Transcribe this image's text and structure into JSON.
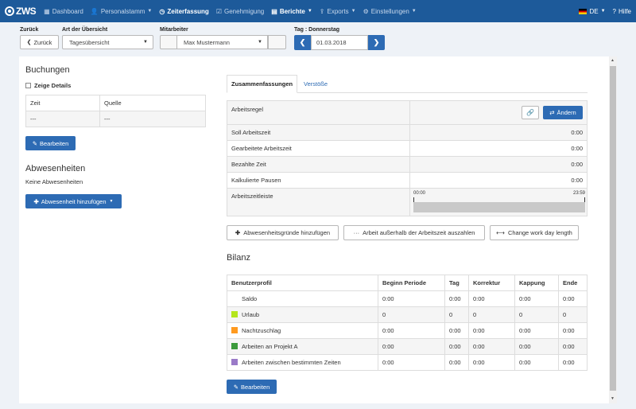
{
  "nav": {
    "logo": "ZWS",
    "items": [
      {
        "label": "Dashboard",
        "icon": "grid-icon",
        "glyph": "▦",
        "active": false,
        "caret": false
      },
      {
        "label": "Personalstamm",
        "icon": "user-icon",
        "glyph": "👤",
        "active": false,
        "caret": true
      },
      {
        "label": "Zeiterfassung",
        "icon": "clock-icon",
        "glyph": "◷",
        "active": true,
        "caret": false
      },
      {
        "label": "Genehmigung",
        "icon": "check-square-icon",
        "glyph": "☑",
        "active": false,
        "caret": false
      },
      {
        "label": "Berichte",
        "icon": "print-icon",
        "glyph": "▤",
        "active": true,
        "caret": true
      },
      {
        "label": "Exports",
        "icon": "export-icon",
        "glyph": "⇪",
        "active": false,
        "caret": true
      },
      {
        "label": "Einstellungen",
        "icon": "gear-icon",
        "glyph": "⚙",
        "active": false,
        "caret": true
      }
    ],
    "language": "DE",
    "help": "Hilfe",
    "help_glyph": "?"
  },
  "filter": {
    "back_label": "Zurück",
    "back_button": "Zurück",
    "overview_label": "Art der Übersicht",
    "overview_value": "Tagesübersicht",
    "employee_label": "Mitarbeiter",
    "employee_value": "Max Mustermann",
    "day_label": "Tag : Donnerstag",
    "date_value": "01.03.2018"
  },
  "left": {
    "bookings_title": "Buchungen",
    "show_details": "Zeige Details",
    "table": {
      "headers": [
        "Zeit",
        "Quelle"
      ],
      "rows": [
        [
          "---",
          "---"
        ]
      ]
    },
    "edit_button": "Bearbeiten",
    "absences_title": "Abwesenheiten",
    "no_absences": "Keine Abwesenheiten",
    "add_absence_button": "Abwesenheit hinzufügen"
  },
  "tabs": {
    "summary": "Zusammenfassungen",
    "violations": "Verstöße"
  },
  "summary": {
    "rule_label": "Arbeitsregel",
    "change_button": "Ändern",
    "rows": [
      {
        "label": "Soll Arbeitszeit",
        "value": "0:00"
      },
      {
        "label": "Gearbeitete Arbeitszeit",
        "value": "0:00"
      },
      {
        "label": "Bezahlte Zeit",
        "value": "0:00"
      },
      {
        "label": "Kalkulierte Pausen",
        "value": "0:00"
      }
    ],
    "timeline_label": "Arbeitszeitleiste",
    "timeline_start": "00:00",
    "timeline_end": "23:59"
  },
  "actions": {
    "add_reasons": "Abwesenheitsgründe hinzufügen",
    "payout": "Arbeit außerhalb der Arbeitszeit auszahlen",
    "change_length": "Change work day length"
  },
  "bilanz": {
    "title": "Bilanz",
    "headers": [
      "Benutzerprofil",
      "Beginn Periode",
      "Tag",
      "Korrektur",
      "Kappung",
      "Ende"
    ],
    "rows": [
      {
        "name": "Saldo",
        "color": "",
        "values": [
          "0:00",
          "0:00",
          "0:00",
          "0:00",
          "0:00"
        ]
      },
      {
        "name": "Urlaub",
        "color": "#b5e61d",
        "values": [
          "0",
          "0",
          "0",
          "0",
          "0"
        ]
      },
      {
        "name": "Nachtzuschlag",
        "color": "#ff9a1f",
        "values": [
          "0:00",
          "0:00",
          "0:00",
          "0:00",
          "0:00"
        ]
      },
      {
        "name": "Arbeiten an Projekt A",
        "color": "#3c9a3c",
        "values": [
          "0:00",
          "0:00",
          "0:00",
          "0:00",
          "0:00"
        ]
      },
      {
        "name": "Arbeiten zwischen bestimmten Zeiten",
        "color": "#9a7ac8",
        "values": [
          "0:00",
          "0:00",
          "0:00",
          "0:00",
          "0:00"
        ]
      }
    ],
    "edit_button": "Bearbeiten"
  },
  "colors": {
    "nav_bg": "#1d5a9a",
    "primary": "#2d6bb4"
  }
}
